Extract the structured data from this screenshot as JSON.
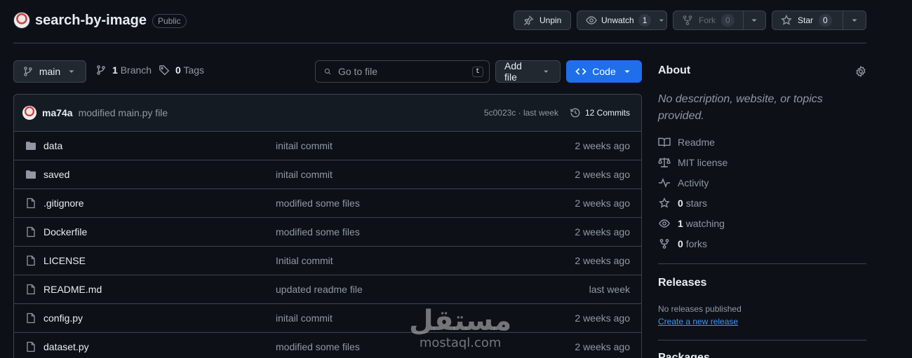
{
  "repo": {
    "name": "search-by-image",
    "visibility": "Public"
  },
  "header_buttons": {
    "unpin": "Unpin",
    "unwatch": "Unwatch",
    "watch_count": "1",
    "fork": "Fork",
    "fork_count": "0",
    "star": "Star",
    "star_count": "0"
  },
  "toolbar": {
    "branch": "main",
    "branch_count": "1",
    "branch_label": "Branch",
    "tag_count": "0",
    "tag_label": "Tags",
    "search_placeholder": "Go to file",
    "search_kbd": "t",
    "add_file": "Add file",
    "code": "Code"
  },
  "commit": {
    "author": "ma74a",
    "message": "modified main.py file",
    "meta": "5c0023c · last week",
    "commits": "12 Commits"
  },
  "files": [
    {
      "type": "folder",
      "name": "data",
      "message": "initail commit",
      "date": "2 weeks ago"
    },
    {
      "type": "folder",
      "name": "saved",
      "message": "initail commit",
      "date": "2 weeks ago"
    },
    {
      "type": "file",
      "name": ".gitignore",
      "message": "modified some files",
      "date": "2 weeks ago"
    },
    {
      "type": "file",
      "name": "Dockerfile",
      "message": "modified some files",
      "date": "2 weeks ago"
    },
    {
      "type": "file",
      "name": "LICENSE",
      "message": "Initial commit",
      "date": "2 weeks ago"
    },
    {
      "type": "file",
      "name": "README.md",
      "message": "updated readme file",
      "date": "last week"
    },
    {
      "type": "file",
      "name": "config.py",
      "message": "initail commit",
      "date": "2 weeks ago"
    },
    {
      "type": "file",
      "name": "dataset.py",
      "message": "modified some files",
      "date": "2 weeks ago"
    }
  ],
  "about": {
    "title": "About",
    "description": "No description, website, or topics provided.",
    "readme": "Readme",
    "license": "MIT license",
    "activity": "Activity",
    "stars_count": "0",
    "stars_label": "stars",
    "watching_count": "1",
    "watching_label": "watching",
    "forks_count": "0",
    "forks_label": "forks"
  },
  "releases": {
    "title": "Releases",
    "none": "No releases published",
    "create": "Create a new release"
  },
  "packages": {
    "title": "Packages"
  },
  "watermark": {
    "arabic": "مستقل",
    "latin": "mostaql.com"
  },
  "colors": {
    "accent": "#1f6feb",
    "link": "#4493f8",
    "bg": "#0d1117"
  },
  "icons": [
    "pin-icon",
    "eye-icon",
    "fork-icon",
    "star-icon",
    "branch-icon",
    "tag-icon",
    "search-icon",
    "code-icon",
    "history-icon",
    "folder-icon",
    "file-icon",
    "gear-icon",
    "book-icon",
    "law-icon",
    "pulse-icon"
  ]
}
